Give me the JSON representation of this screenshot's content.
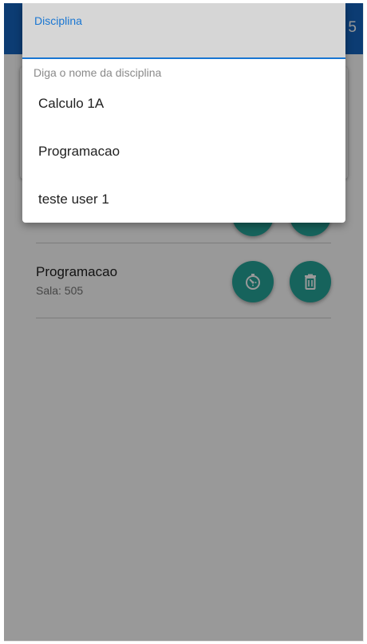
{
  "app_bar": {
    "trailing_text": "5"
  },
  "list": {
    "items": [
      {
        "title": "Programacao",
        "subtitle": "Sala: 505"
      }
    ]
  },
  "dropdown": {
    "label": "Disciplina",
    "helper": "Diga o nome da disciplina",
    "options": [
      "Calculo 1A",
      "Programacao",
      "teste user 1"
    ]
  },
  "icons": {
    "clock": "timer-icon",
    "delete": "trash-icon"
  },
  "colors": {
    "primary": "#1565c0",
    "accent": "#1976d2",
    "fab": "#26a69a",
    "scrim": "rgba(0,0,0,0.4)"
  }
}
